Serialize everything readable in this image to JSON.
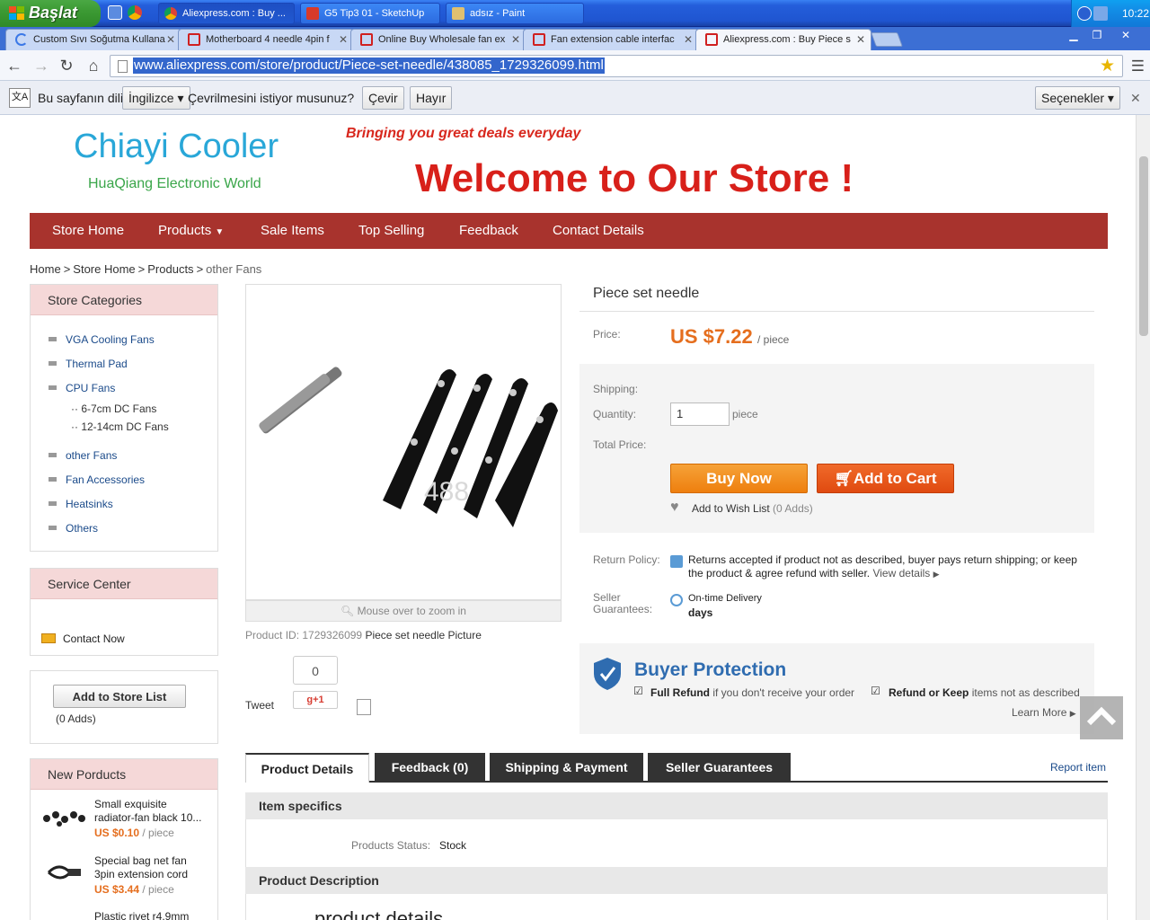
{
  "taskbar": {
    "start_label": "Başlat",
    "tasks": [
      "Aliexpress.com : Buy ...",
      "G5 Tip3 01 - SketchUp",
      "adsız - Paint"
    ],
    "clock": "10:22"
  },
  "browser": {
    "tabs": [
      {
        "label": "Custom Sıvı Soğutma Kullana"
      },
      {
        "label": "Motherboard 4 needle 4pin f"
      },
      {
        "label": "Online Buy Wholesale fan ex"
      },
      {
        "label": "Fan extension cable interfac"
      },
      {
        "label": "Aliexpress.com : Buy Piece s"
      }
    ],
    "url": "www.aliexpress.com/store/product/Piece-set-needle/438085_1729326099.html",
    "translate": {
      "prefix": "Bu sayfanın dili",
      "language": "İngilizce",
      "question": "Çevrilmesini istiyor musunuz?",
      "translate_btn": "Çevir",
      "no_btn": "Hayır",
      "options": "Seçenekler"
    }
  },
  "store": {
    "name": "Chiayi Cooler",
    "subtitle": "HuaQiang Electronic World",
    "tagline": "Bringing you great deals everyday",
    "welcome": "Welcome to Our Store !",
    "nav": [
      "Store Home",
      "Products",
      "Sale Items",
      "Top Selling",
      "Feedback",
      "Contact Details"
    ]
  },
  "breadcrumb": {
    "home": "Home",
    "store_home": "Store Home",
    "products": "Products",
    "current": "other Fans"
  },
  "sidebar": {
    "categories_title": "Store Categories",
    "categories": [
      "VGA Cooling Fans",
      "Thermal Pad",
      "CPU Fans",
      "other Fans",
      "Fan Accessories",
      "Heatsinks",
      "Others"
    ],
    "subcategories": [
      "6-7cm DC Fans",
      "12-14cm DC Fans"
    ],
    "service_title": "Service Center",
    "contact": "Contact Now",
    "add_store": "Add to Store List",
    "adds": "(0 Adds)",
    "new_title": "New Porducts",
    "new_products": [
      {
        "name": "Small exquisite radiator-fan black 10...",
        "price": "US $0.10",
        "unit": "/ piece"
      },
      {
        "name": "Special bag net fan 3pin extension cord",
        "price": "US $3.44",
        "unit": "/ piece"
      },
      {
        "name": "Plastic rivet r4.9mm",
        "price": "",
        "unit": ""
      }
    ]
  },
  "product": {
    "title": "Piece set needle",
    "price_label": "Price:",
    "price": "US $7.22",
    "price_unit": "/ piece",
    "shipping_label": "Shipping:",
    "quantity_label": "Quantity:",
    "quantity": "1",
    "quantity_unit": "piece",
    "total_label": "Total Price:",
    "buy_now": "Buy Now",
    "add_to_cart": "Add to Cart",
    "wish": "Add to Wish List",
    "wish_count": "(0 Adds)",
    "return_label": "Return Policy:",
    "return_text": "Returns accepted if product not as described, buyer pays return shipping; or keep the product & agree refund with seller.",
    "view_details": "View details",
    "seller_label": "Seller Guarantees:",
    "ontime": "On-time Delivery",
    "days": "days",
    "zoom_hint": "Mouse over to zoom in",
    "id_label": "Product ID: 1729326099",
    "picture_label": "Piece set needle Picture",
    "watermark": "488",
    "tweet": "Tweet",
    "gplus_count": "0",
    "gplus": "+1"
  },
  "protection": {
    "title": "Buyer Protection",
    "full_refund": "Full Refund",
    "full_refund_desc": "if you don't receive your order",
    "refund_keep": "Refund or Keep",
    "refund_keep_desc": "items not as described",
    "learn_more": "Learn More"
  },
  "tabs": {
    "items": [
      "Product Details",
      "Feedback (0)",
      "Shipping & Payment",
      "Seller Guarantees"
    ],
    "report": "Report item"
  },
  "specifics": {
    "title": "Item specifics",
    "status_label": "Products Status:",
    "status_value": "Stock",
    "desc_title": "Product Description",
    "desc_text": "product details"
  }
}
